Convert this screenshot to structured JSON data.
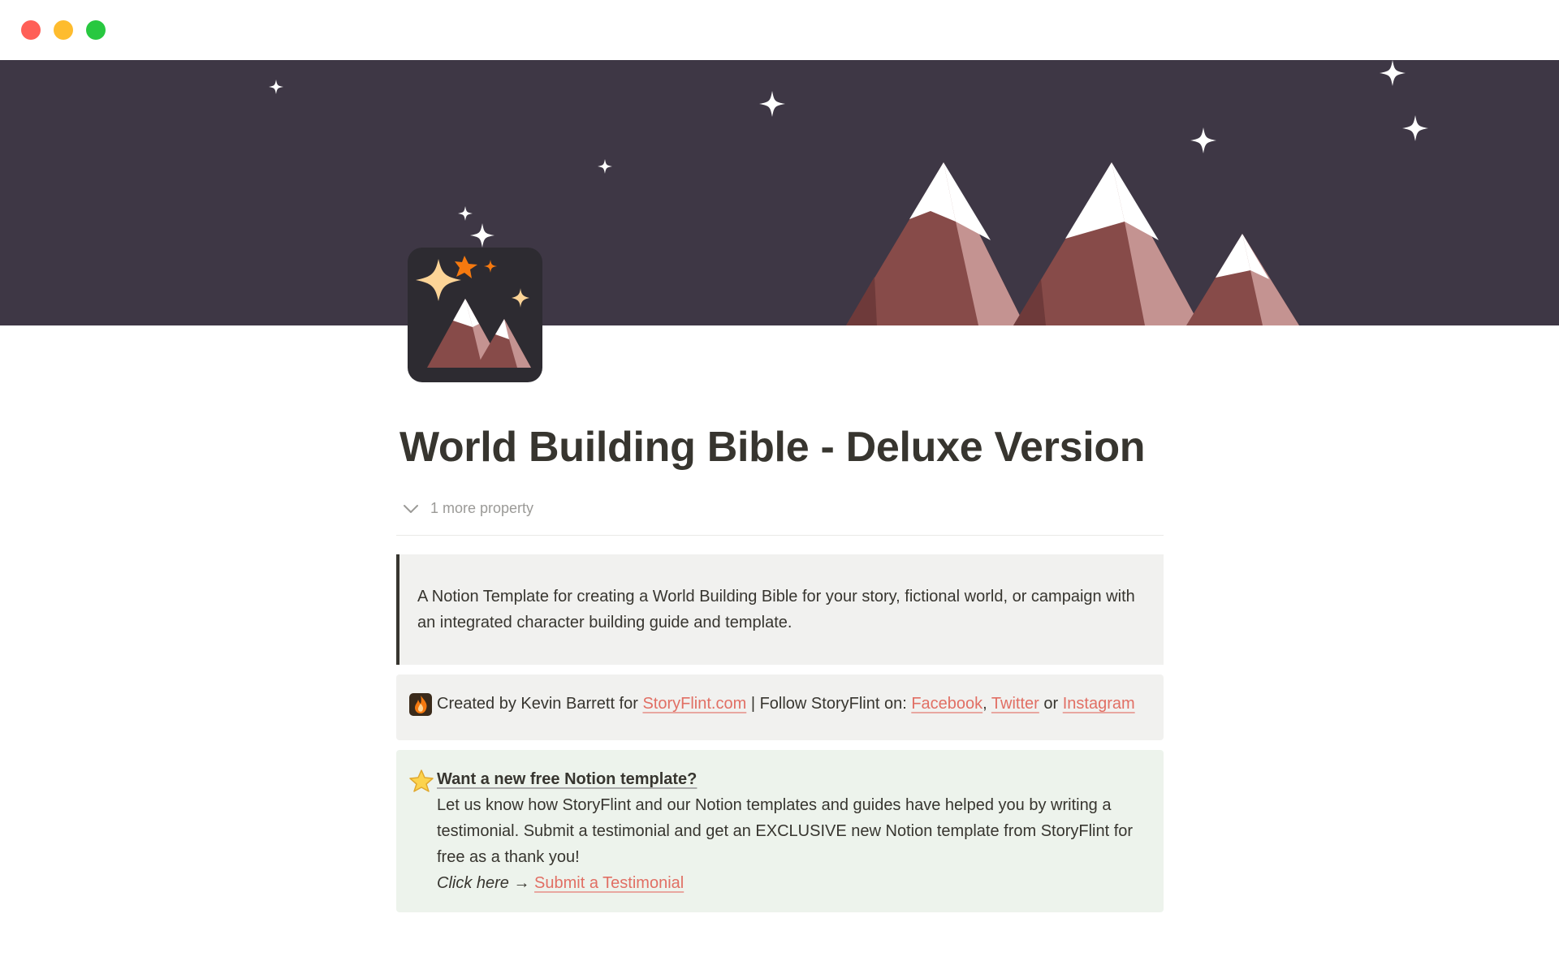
{
  "window": {
    "traffic_lights": [
      "close",
      "minimize",
      "maximize"
    ]
  },
  "cover": {
    "icon": "mountains-stars-cover",
    "colors": {
      "sky": "#3e3745",
      "mountain_dark": "#874b49",
      "mountain_light": "#c49391",
      "snow": "#ffffff"
    }
  },
  "page_icon": {
    "icon": "mountains-sparkles-icon"
  },
  "page": {
    "title": "World Building Bible - Deluxe Version",
    "more_property_label": "1 more property"
  },
  "quote": {
    "text": "A Notion Template for creating a World Building Bible for your story, fictional world, or campaign with an integrated character building guide and template."
  },
  "credits_callout": {
    "icon": "flame-icon",
    "prefix": "Created by Kevin Barrett for ",
    "storyflint_link": "StoryFlint.com",
    "follow_text": " | Follow StoryFlint on: ",
    "facebook_link": "Facebook",
    "comma": ", ",
    "twitter_link": "Twitter",
    "or_text": " or",
    "instagram_link": "Instagram"
  },
  "testimonial_callout": {
    "icon": "star-icon",
    "heading": "Want a new free Notion template?",
    "body": "Let us know how StoryFlint and our Notion templates and guides have helped you by writing a testimonial. Submit a testimonial and get an EXCLUSIVE new Notion template from StoryFlint for free as a thank you!",
    "click_here": "Click here",
    "arrow": " → ",
    "submit_link": "Submit a Testimonial"
  },
  "colors": {
    "text": "#37352f",
    "muted": "#9b9a97",
    "link": "#e16f64",
    "callout_gray": "#f1f1ef",
    "callout_green": "#edf3ec"
  }
}
